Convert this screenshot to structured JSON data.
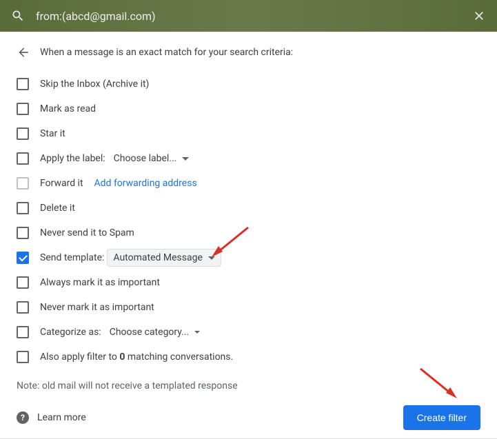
{
  "search": {
    "query": "from:(abcd@gmail.com)"
  },
  "header": "When a message is an exact match for your search criteria:",
  "options": {
    "skip_inbox": "Skip the Inbox (Archive it)",
    "mark_read": "Mark as read",
    "star": "Star it",
    "apply_label": "Apply the label:",
    "apply_label_value": "Choose label...",
    "forward": "Forward it",
    "forward_link": "Add forwarding address",
    "delete": "Delete it",
    "never_spam": "Never send it to Spam",
    "send_template": "Send template:",
    "send_template_value": "Automated Message",
    "always_important": "Always mark it as important",
    "never_important": "Never mark it as important",
    "categorize": "Categorize as:",
    "categorize_value": "Choose category...",
    "also_apply_pre": "Also apply filter to ",
    "also_apply_count": "0",
    "also_apply_post": " matching conversations."
  },
  "note": "Note: old mail will not receive a templated response",
  "learn_more": "Learn more",
  "create_button": "Create filter"
}
